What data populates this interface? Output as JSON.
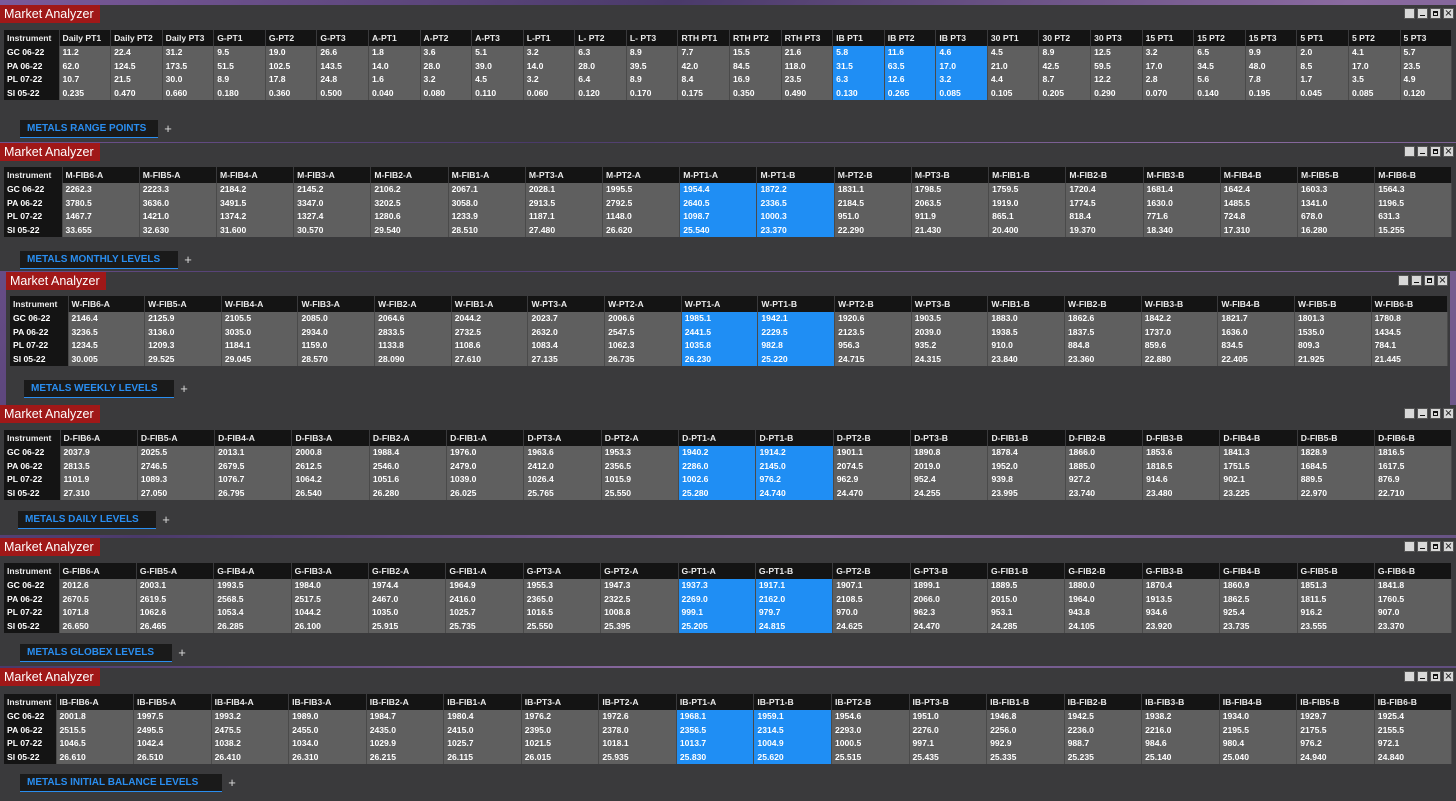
{
  "rows": [
    "GC 06-22",
    "PA 06-22",
    "PL 07-22",
    "SI 05-22"
  ],
  "panels": [
    {
      "title": "Market Analyzer",
      "tab": "METALS RANGE POINTS",
      "columns": [
        "Instrument",
        "Daily PT1",
        "Daily PT2",
        "Daily PT3",
        "G-PT1",
        "G-PT2",
        "G-PT3",
        "A-PT1",
        "A-PT2",
        "A-PT3",
        "L-PT1",
        "L- PT2",
        "L- PT3",
        "RTH PT1",
        "RTH PT2",
        "RTH PT3",
        "IB PT1",
        "IB PT2",
        "IB PT3",
        "30 PT1",
        "30 PT2",
        "30 PT3",
        "15 PT1",
        "15 PT2",
        "15 PT3",
        "5 PT1",
        "5 PT2",
        "5 PT3"
      ],
      "highlight": [
        16,
        17,
        18
      ],
      "data": [
        [
          "11.2",
          "22.4",
          "31.2",
          "9.5",
          "19.0",
          "26.6",
          "1.8",
          "3.6",
          "5.1",
          "3.2",
          "6.3",
          "8.9",
          "7.7",
          "15.5",
          "21.6",
          "5.8",
          "11.6",
          "4.6",
          "4.5",
          "8.9",
          "12.5",
          "3.2",
          "6.5",
          "9.9",
          "2.0",
          "4.1",
          "5.7"
        ],
        [
          "62.0",
          "124.5",
          "173.5",
          "51.5",
          "102.5",
          "143.5",
          "14.0",
          "28.0",
          "39.0",
          "14.0",
          "28.0",
          "39.5",
          "42.0",
          "84.5",
          "118.0",
          "31.5",
          "63.5",
          "17.0",
          "21.0",
          "42.5",
          "59.5",
          "17.0",
          "34.5",
          "48.0",
          "8.5",
          "17.0",
          "23.5"
        ],
        [
          "10.7",
          "21.5",
          "30.0",
          "8.9",
          "17.8",
          "24.8",
          "1.6",
          "3.2",
          "4.5",
          "3.2",
          "6.4",
          "8.9",
          "8.4",
          "16.9",
          "23.5",
          "6.3",
          "12.6",
          "3.2",
          "4.4",
          "8.7",
          "12.2",
          "2.8",
          "5.6",
          "7.8",
          "1.7",
          "3.5",
          "4.9"
        ],
        [
          "0.235",
          "0.470",
          "0.660",
          "0.180",
          "0.360",
          "0.500",
          "0.040",
          "0.080",
          "0.110",
          "0.060",
          "0.120",
          "0.170",
          "0.175",
          "0.350",
          "0.490",
          "0.130",
          "0.265",
          "0.085",
          "0.105",
          "0.205",
          "0.290",
          "0.070",
          "0.140",
          "0.195",
          "0.045",
          "0.085",
          "0.120"
        ]
      ]
    },
    {
      "title": "Market Analyzer",
      "tab": "METALS MONTHLY LEVELS",
      "columns": [
        "Instrument",
        "M-FIB6-A",
        "M-FIB5-A",
        "M-FIB4-A",
        "M-FIB3-A",
        "M-FIB2-A",
        "M-FIB1-A",
        "M-PT3-A",
        "M-PT2-A",
        "M-PT1-A",
        "M-PT1-B",
        "M-PT2-B",
        "M-PT3-B",
        "M-FIB1-B",
        "M-FIB2-B",
        "M-FIB3-B",
        "M-FIB4-B",
        "M-FIB5-B",
        "M-FIB6-B"
      ],
      "highlight": [
        9,
        10
      ],
      "data": [
        [
          "2262.3",
          "2223.3",
          "2184.2",
          "2145.2",
          "2106.2",
          "2067.1",
          "2028.1",
          "1995.5",
          "1954.4",
          "1872.2",
          "1831.1",
          "1798.5",
          "1759.5",
          "1720.4",
          "1681.4",
          "1642.4",
          "1603.3",
          "1564.3"
        ],
        [
          "3780.5",
          "3636.0",
          "3491.5",
          "3347.0",
          "3202.5",
          "3058.0",
          "2913.5",
          "2792.5",
          "2640.5",
          "2336.5",
          "2184.5",
          "2063.5",
          "1919.0",
          "1774.5",
          "1630.0",
          "1485.5",
          "1341.0",
          "1196.5"
        ],
        [
          "1467.7",
          "1421.0",
          "1374.2",
          "1327.4",
          "1280.6",
          "1233.9",
          "1187.1",
          "1148.0",
          "1098.7",
          "1000.3",
          "951.0",
          "911.9",
          "865.1",
          "818.4",
          "771.6",
          "724.8",
          "678.0",
          "631.3"
        ],
        [
          "33.655",
          "32.630",
          "31.600",
          "30.570",
          "29.540",
          "28.510",
          "27.480",
          "26.620",
          "25.540",
          "23.370",
          "22.290",
          "21.430",
          "20.400",
          "19.370",
          "18.340",
          "17.310",
          "16.280",
          "15.255"
        ]
      ]
    },
    {
      "title": "Market Analyzer",
      "tab": "METALS WEEKLY LEVELS",
      "columns": [
        "Instrument",
        "W-FIB6-A",
        "W-FIB5-A",
        "W-FIB4-A",
        "W-FIB3-A",
        "W-FIB2-A",
        "W-FIB1-A",
        "W-PT3-A",
        "W-PT2-A",
        "W-PT1-A",
        "W-PT1-B",
        "W-PT2-B",
        "W-PT3-B",
        "W-FIB1-B",
        "W-FIB2-B",
        "W-FIB3-B",
        "W-FIB4-B",
        "W-FIB5-B",
        "W-FIB6-B"
      ],
      "highlight": [
        9,
        10
      ],
      "data": [
        [
          "2146.4",
          "2125.9",
          "2105.5",
          "2085.0",
          "2064.6",
          "2044.2",
          "2023.7",
          "2006.6",
          "1985.1",
          "1942.1",
          "1920.6",
          "1903.5",
          "1883.0",
          "1862.6",
          "1842.2",
          "1821.7",
          "1801.3",
          "1780.8"
        ],
        [
          "3236.5",
          "3136.0",
          "3035.0",
          "2934.0",
          "2833.5",
          "2732.5",
          "2632.0",
          "2547.5",
          "2441.5",
          "2229.5",
          "2123.5",
          "2039.0",
          "1938.5",
          "1837.5",
          "1737.0",
          "1636.0",
          "1535.0",
          "1434.5"
        ],
        [
          "1234.5",
          "1209.3",
          "1184.1",
          "1159.0",
          "1133.8",
          "1108.6",
          "1083.4",
          "1062.3",
          "1035.8",
          "982.8",
          "956.3",
          "935.2",
          "910.0",
          "884.8",
          "859.6",
          "834.5",
          "809.3",
          "784.1"
        ],
        [
          "30.005",
          "29.525",
          "29.045",
          "28.570",
          "28.090",
          "27.610",
          "27.135",
          "26.735",
          "26.230",
          "25.220",
          "24.715",
          "24.315",
          "23.840",
          "23.360",
          "22.880",
          "22.405",
          "21.925",
          "21.445"
        ]
      ]
    },
    {
      "title": "Market Analyzer",
      "tab": "METALS DAILY LEVELS",
      "columns": [
        "Instrument",
        "D-FIB6-A",
        "D-FIB5-A",
        "D-FIB4-A",
        "D-FIB3-A",
        "D-FIB2-A",
        "D-FIB1-A",
        "D-PT3-A",
        "D-PT2-A",
        "D-PT1-A",
        "D-PT1-B",
        "D-PT2-B",
        "D-PT3-B",
        "D-FIB1-B",
        "D-FIB2-B",
        "D-FIB3-B",
        "D-FIB4-B",
        "D-FIB5-B",
        "D-FIB6-B"
      ],
      "highlight": [
        9,
        10
      ],
      "data": [
        [
          "2037.9",
          "2025.5",
          "2013.1",
          "2000.8",
          "1988.4",
          "1976.0",
          "1963.6",
          "1953.3",
          "1940.2",
          "1914.2",
          "1901.1",
          "1890.8",
          "1878.4",
          "1866.0",
          "1853.6",
          "1841.3",
          "1828.9",
          "1816.5"
        ],
        [
          "2813.5",
          "2746.5",
          "2679.5",
          "2612.5",
          "2546.0",
          "2479.0",
          "2412.0",
          "2356.5",
          "2286.0",
          "2145.0",
          "2074.5",
          "2019.0",
          "1952.0",
          "1885.0",
          "1818.5",
          "1751.5",
          "1684.5",
          "1617.5"
        ],
        [
          "1101.9",
          "1089.3",
          "1076.7",
          "1064.2",
          "1051.6",
          "1039.0",
          "1026.4",
          "1015.9",
          "1002.6",
          "976.2",
          "962.9",
          "952.4",
          "939.8",
          "927.2",
          "914.6",
          "902.1",
          "889.5",
          "876.9"
        ],
        [
          "27.310",
          "27.050",
          "26.795",
          "26.540",
          "26.280",
          "26.025",
          "25.765",
          "25.550",
          "25.280",
          "24.740",
          "24.470",
          "24.255",
          "23.995",
          "23.740",
          "23.480",
          "23.225",
          "22.970",
          "22.710"
        ]
      ]
    },
    {
      "title": "Market Analyzer",
      "tab": "METALS GLOBEX LEVELS",
      "columns": [
        "Instrument",
        "G-FIB6-A",
        "G-FIB5-A",
        "G-FIB4-A",
        "G-FIB3-A",
        "G-FIB2-A",
        "G-FIB1-A",
        "G-PT3-A",
        "G-PT2-A",
        "G-PT1-A",
        "G-PT1-B",
        "G-PT2-B",
        "G-PT3-B",
        "G-FIB1-B",
        "G-FIB2-B",
        "G-FIB3-B",
        "G-FIB4-B",
        "G-FIB5-B",
        "G-FIB6-B"
      ],
      "highlight": [
        9,
        10
      ],
      "data": [
        [
          "2012.6",
          "2003.1",
          "1993.5",
          "1984.0",
          "1974.4",
          "1964.9",
          "1955.3",
          "1947.3",
          "1937.3",
          "1917.1",
          "1907.1",
          "1899.1",
          "1889.5",
          "1880.0",
          "1870.4",
          "1860.9",
          "1851.3",
          "1841.8"
        ],
        [
          "2670.5",
          "2619.5",
          "2568.5",
          "2517.5",
          "2467.0",
          "2416.0",
          "2365.0",
          "2322.5",
          "2269.0",
          "2162.0",
          "2108.5",
          "2066.0",
          "2015.0",
          "1964.0",
          "1913.5",
          "1862.5",
          "1811.5",
          "1760.5"
        ],
        [
          "1071.8",
          "1062.6",
          "1053.4",
          "1044.2",
          "1035.0",
          "1025.7",
          "1016.5",
          "1008.8",
          "999.1",
          "979.7",
          "970.0",
          "962.3",
          "953.1",
          "943.8",
          "934.6",
          "925.4",
          "916.2",
          "907.0"
        ],
        [
          "26.650",
          "26.465",
          "26.285",
          "26.100",
          "25.915",
          "25.735",
          "25.550",
          "25.395",
          "25.205",
          "24.815",
          "24.625",
          "24.470",
          "24.285",
          "24.105",
          "23.920",
          "23.735",
          "23.555",
          "23.370"
        ]
      ]
    },
    {
      "title": "Market Analyzer",
      "tab": "METALS  INITIAL BALANCE LEVELS",
      "columns": [
        "Instrument",
        "IB-FIB6-A",
        "IB-FIB5-A",
        "IB-FIB4-A",
        "IB-FIB3-A",
        "IB-FIB2-A",
        "IB-FIB1-A",
        "IB-PT3-A",
        "IB-PT2-A",
        "IB-PT1-A",
        "IB-PT1-B",
        "IB-PT2-B",
        "IB-PT3-B",
        "IB-FIB1-B",
        "IB-FIB2-B",
        "IB-FIB3-B",
        "IB-FIB4-B",
        "IB-FIB5-B",
        "IB-FIB6-B"
      ],
      "highlight": [
        9,
        10
      ],
      "data": [
        [
          "2001.8",
          "1997.5",
          "1993.2",
          "1989.0",
          "1984.7",
          "1980.4",
          "1976.2",
          "1972.6",
          "1968.1",
          "1959.1",
          "1954.6",
          "1951.0",
          "1946.8",
          "1942.5",
          "1938.2",
          "1934.0",
          "1929.7",
          "1925.4"
        ],
        [
          "2515.5",
          "2495.5",
          "2475.5",
          "2455.0",
          "2435.0",
          "2415.0",
          "2395.0",
          "2378.0",
          "2356.5",
          "2314.5",
          "2293.0",
          "2276.0",
          "2256.0",
          "2236.0",
          "2216.0",
          "2195.5",
          "2175.5",
          "2155.5"
        ],
        [
          "1046.5",
          "1042.4",
          "1038.2",
          "1034.0",
          "1029.9",
          "1025.7",
          "1021.5",
          "1018.1",
          "1013.7",
          "1004.9",
          "1000.5",
          "997.1",
          "992.9",
          "988.7",
          "984.6",
          "980.4",
          "976.2",
          "972.1"
        ],
        [
          "26.610",
          "26.510",
          "26.410",
          "26.310",
          "26.215",
          "26.115",
          "26.015",
          "25.935",
          "25.830",
          "25.620",
          "25.515",
          "25.435",
          "25.335",
          "25.235",
          "25.140",
          "25.040",
          "24.940",
          "24.840"
        ]
      ]
    }
  ],
  "window_buttons": {
    "minimize_icon": "minimize-icon",
    "maximize_icon": "maximize-icon",
    "close_symbol": "×"
  },
  "tab_add": "+"
}
